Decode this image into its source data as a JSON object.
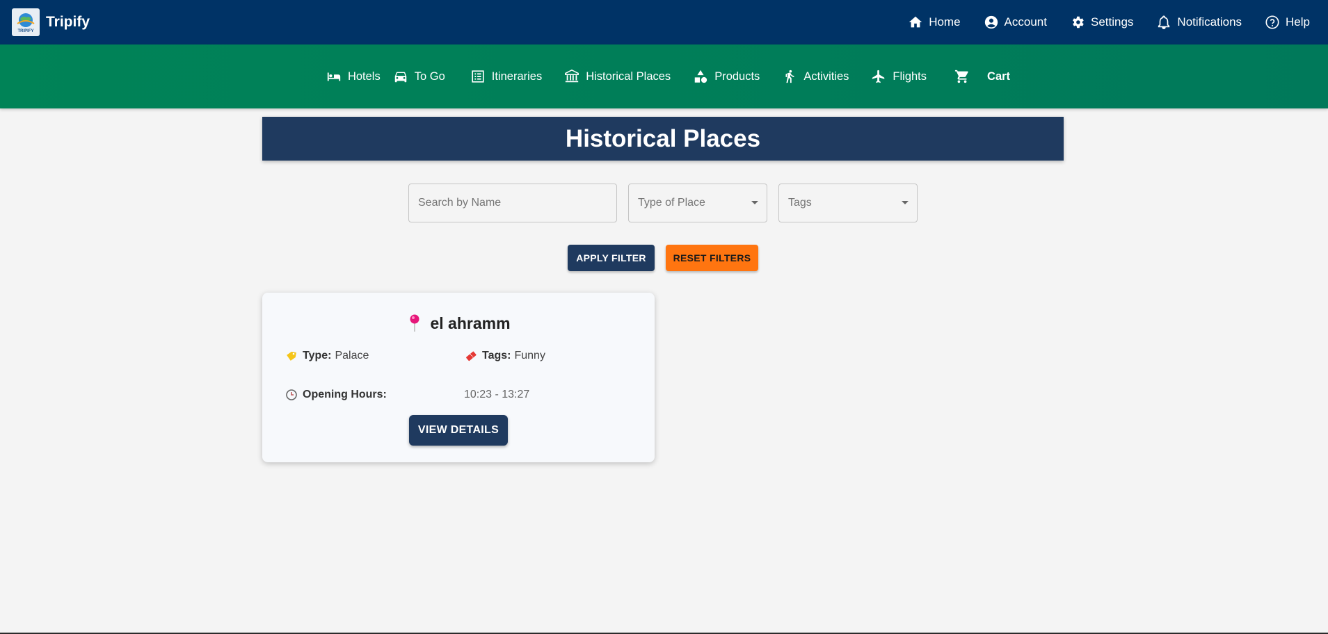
{
  "brand": {
    "name": "Tripify",
    "logo_text": "TRIPIFY"
  },
  "top_nav": [
    {
      "label": "Home",
      "icon": "home-icon"
    },
    {
      "label": "Account",
      "icon": "account-circle-icon"
    },
    {
      "label": "Settings",
      "icon": "gear-icon"
    },
    {
      "label": "Notifications",
      "icon": "bell-icon"
    },
    {
      "label": "Help",
      "icon": "help-circle-icon"
    }
  ],
  "category_nav": [
    {
      "label": "Hotels",
      "icon": "bed-icon"
    },
    {
      "label": "To Go",
      "icon": "car-icon"
    },
    {
      "label": "Itineraries",
      "icon": "list-icon"
    },
    {
      "label": "Historical Places",
      "icon": "museum-icon"
    },
    {
      "label": "Products",
      "icon": "shapes-icon"
    },
    {
      "label": "Activities",
      "icon": "running-icon"
    },
    {
      "label": "Flights",
      "icon": "airplane-icon"
    },
    {
      "label": "Cart",
      "icon": "cart-icon"
    }
  ],
  "page": {
    "title": "Historical Places"
  },
  "filters": {
    "search_placeholder": "Search by Name",
    "type_placeholder": "Type of Place",
    "tags_placeholder": "Tags",
    "apply_label": "APPLY FILTER",
    "reset_label": "RESET FILTERS"
  },
  "places": [
    {
      "name": "el ahramm",
      "type_label": "Type:",
      "type": "Palace",
      "tags_label": "Tags:",
      "tags": "Funny",
      "hours_label": "Opening Hours:",
      "hours": "10:23 - 13:27",
      "details_label": "VIEW DETAILS"
    }
  ],
  "colors": {
    "top_bar": "#003366",
    "category_bar": "#00795a",
    "header": "#1f3a5f",
    "reset_button": "#ff7510"
  }
}
